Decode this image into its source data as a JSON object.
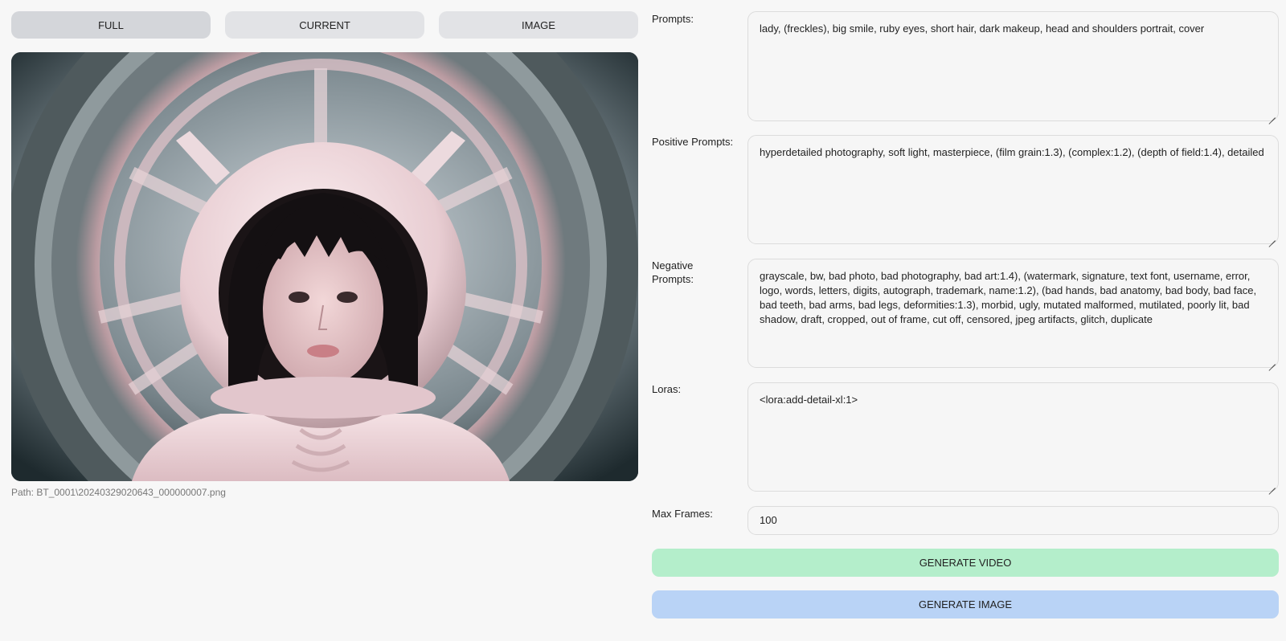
{
  "tabs": {
    "full": "FULL",
    "current": "CURRENT",
    "image": "IMAGE"
  },
  "preview": {
    "path_text": "Path: BT_0001\\20240329020643_000000007.png"
  },
  "fields": {
    "prompts": {
      "label": "Prompts:",
      "value": "lady, (freckles), big smile, ruby eyes, short hair, dark makeup, head and shoulders portrait, cover"
    },
    "positive": {
      "label": "Positive Prompts:",
      "value": "hyperdetailed photography, soft light, masterpiece, (film grain:1.3), (complex:1.2), (depth of field:1.4), detailed"
    },
    "negative": {
      "label": "Negative Prompts:",
      "value": "grayscale, bw, bad photo, bad photography, bad art:1.4), (watermark, signature, text font, username, error, logo, words, letters, digits, autograph, trademark, name:1.2), (bad hands, bad anatomy, bad body, bad face, bad teeth, bad arms, bad legs, deformities:1.3), morbid, ugly, mutated malformed, mutilated, poorly lit, bad shadow, draft, cropped, out of frame, cut off, censored, jpeg artifacts, glitch, duplicate"
    },
    "loras": {
      "label": "Loras:",
      "value": "<lora:add-detail-xl:1>"
    },
    "max_frames": {
      "label": "Max Frames:",
      "value": "100"
    }
  },
  "buttons": {
    "generate_video": "GENERATE VIDEO",
    "generate_image": "GENERATE IMAGE"
  },
  "colors": {
    "background": "#f7f7f7",
    "tab": "#e2e3e6",
    "generate_video": "#b4eecb",
    "generate_image": "#b9d3f6"
  }
}
